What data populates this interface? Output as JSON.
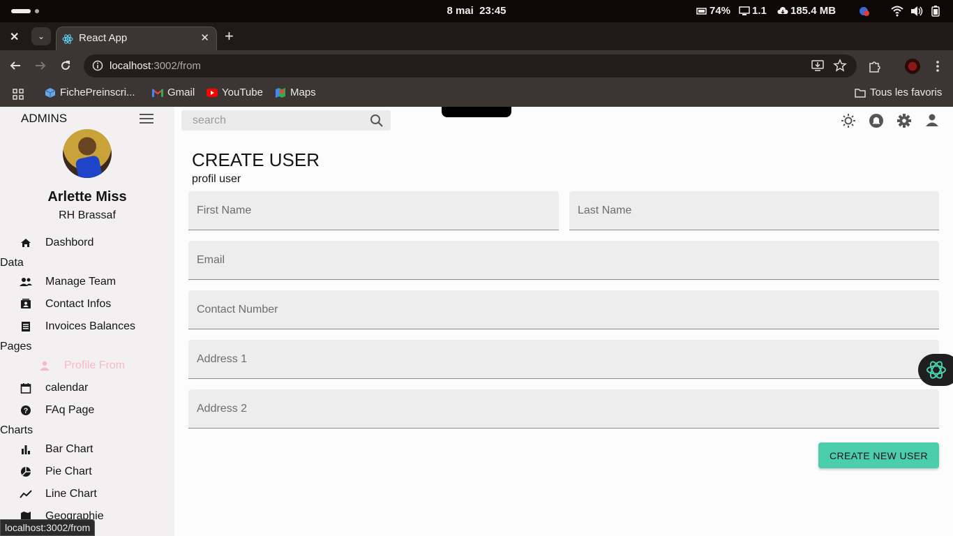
{
  "os": {
    "date": "8 mai",
    "time": "23:45",
    "battery_stat": "74%",
    "load_stat": "1.1",
    "memory_stat": "185.4 MB"
  },
  "browser": {
    "tab_title": "React App",
    "url_host": "localhost",
    "url_path": ":3002/from",
    "bookmarks": [
      {
        "label": "FichePreinscri..."
      },
      {
        "label": "Gmail"
      },
      {
        "label": "YouTube"
      },
      {
        "label": "Maps"
      }
    ],
    "all_bookmarks": "Tous les favoris",
    "status_url": "localhost:3002/from"
  },
  "sidebar": {
    "header": "ADMINS",
    "user_name": "Arlette Miss",
    "user_role": "RH Brassaf",
    "dashboard": "Dashbord",
    "sections": {
      "data": "Data",
      "pages": "Pages",
      "charts": "Charts"
    },
    "items": {
      "manage_team": "Manage Team",
      "contact_infos": "Contact Infos",
      "invoices_balances": "Invoices Balances",
      "profile_from": "Profile From",
      "calendar": "calendar",
      "faq": "FAq Page",
      "bar_chart": "Bar Chart",
      "pie_chart": "Pie Chart",
      "line_chart": "Line Chart",
      "geographie": "Geographie"
    }
  },
  "topbar": {
    "search_placeholder": "search"
  },
  "form": {
    "title": "CREATE USER",
    "subtitle": "profil user",
    "first_name": "First Name",
    "last_name": "Last Name",
    "email": "Email",
    "contact_number": "Contact Number",
    "address1": "Address 1",
    "address2": "Address 2",
    "submit": "CREATE NEW USER"
  },
  "colors": {
    "accent": "#4cceac",
    "active_nav": "#f8b9c5",
    "sidebar_bg": "#f2f0f0"
  }
}
